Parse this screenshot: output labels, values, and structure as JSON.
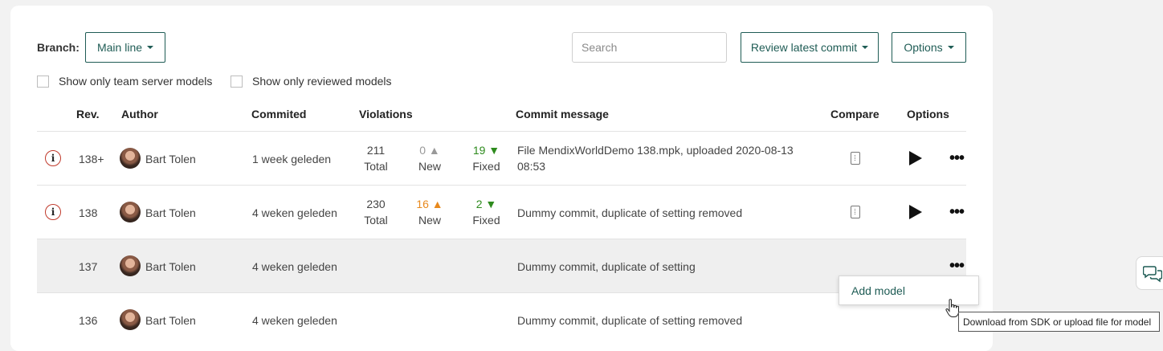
{
  "branch": {
    "label": "Branch:",
    "value": "Main line"
  },
  "search": {
    "placeholder": "Search"
  },
  "toolbar": {
    "review_label": "Review latest commit",
    "options_label": "Options"
  },
  "filters": [
    {
      "label": "Show only team server models",
      "checked": false
    },
    {
      "label": "Show only reviewed models",
      "checked": false
    }
  ],
  "table": {
    "headers": {
      "rev": "Rev.",
      "author": "Author",
      "committed": "Commited",
      "violations": "Violations",
      "message": "Commit message",
      "compare": "Compare",
      "options": "Options"
    },
    "rows": [
      {
        "rev": "138+",
        "author": "Bart Tolen",
        "committed": "1 week geleden",
        "total": "211",
        "total_label": "Total",
        "new": "0 ▲",
        "new_label": "New",
        "fixed": "19 ▼",
        "fixed_label": "Fixed",
        "message_line1": "File MendixWorldDemo 138.mpk, uploaded 2020-08-13",
        "message_line2": "08:53",
        "info": "i"
      },
      {
        "rev": "138",
        "author": "Bart Tolen",
        "committed": "4 weken geleden",
        "total": "230",
        "total_label": "Total",
        "new": "16 ▲",
        "new_label": "New",
        "fixed": "2 ▼",
        "fixed_label": "Fixed",
        "message_line1": "Dummy commit, duplicate of setting removed",
        "info": "i"
      },
      {
        "rev": "137",
        "author": "Bart Tolen",
        "committed": "4 weken geleden",
        "message_line1": "Dummy commit, duplicate of setting"
      },
      {
        "rev": "136",
        "author": "Bart Tolen",
        "committed": "4 weken geleden",
        "message_line1": "Dummy commit, duplicate of setting removed"
      }
    ]
  },
  "row_menu": {
    "item": "Add model"
  },
  "tooltip": {
    "text": "Download from SDK or upload file for model"
  },
  "colors": {
    "accent": "#1f5c55",
    "new_warning": "#e8891d",
    "fixed_ok": "#2e8b1e",
    "info_ring": "#c0392b"
  }
}
